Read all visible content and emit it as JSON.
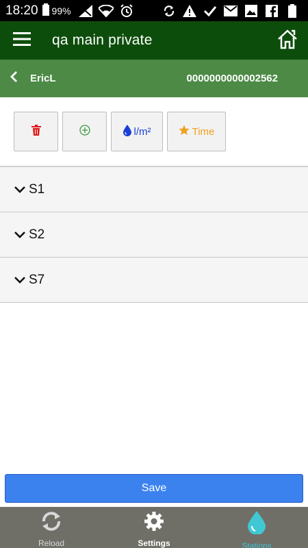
{
  "status_bar": {
    "time": "18:20",
    "battery": "99%",
    "icons": [
      "signal-icon",
      "wifi-icon",
      "alarm-icon",
      "sync-icon",
      "warning-icon",
      "check-icon",
      "mail-icon",
      "image-icon",
      "facebook-icon",
      "battery-icon"
    ]
  },
  "app_bar": {
    "title": "qa main private",
    "menu_icon": "hamburger-icon",
    "home_icon": "home-icon"
  },
  "sub_header": {
    "user": "EricL",
    "serial": "0000000000002562"
  },
  "toolbar": {
    "delete_icon": "trash-icon",
    "add_icon": "plus-circle-icon",
    "water_label": "l/m²",
    "time_label": "Time"
  },
  "stations": [
    {
      "label": "S1"
    },
    {
      "label": "S2"
    },
    {
      "label": "S7"
    }
  ],
  "save_label": "Save",
  "bottom_nav": {
    "items": [
      {
        "label": "Reload",
        "icon": "reload-icon"
      },
      {
        "label": "Settings",
        "icon": "gear-icon"
      },
      {
        "label": "Stations",
        "icon": "water-drop-icon"
      }
    ]
  },
  "colors": {
    "app_bar": "#0d4d0b",
    "sub_header": "#4c8a46",
    "save": "#3b82ef",
    "nav_bg": "#6f6f68",
    "active_nav": "#3fc8d4",
    "delete": "#e01818",
    "add": "#3a9a3a",
    "water": "#1a3fd6",
    "time": "#f0a020"
  }
}
